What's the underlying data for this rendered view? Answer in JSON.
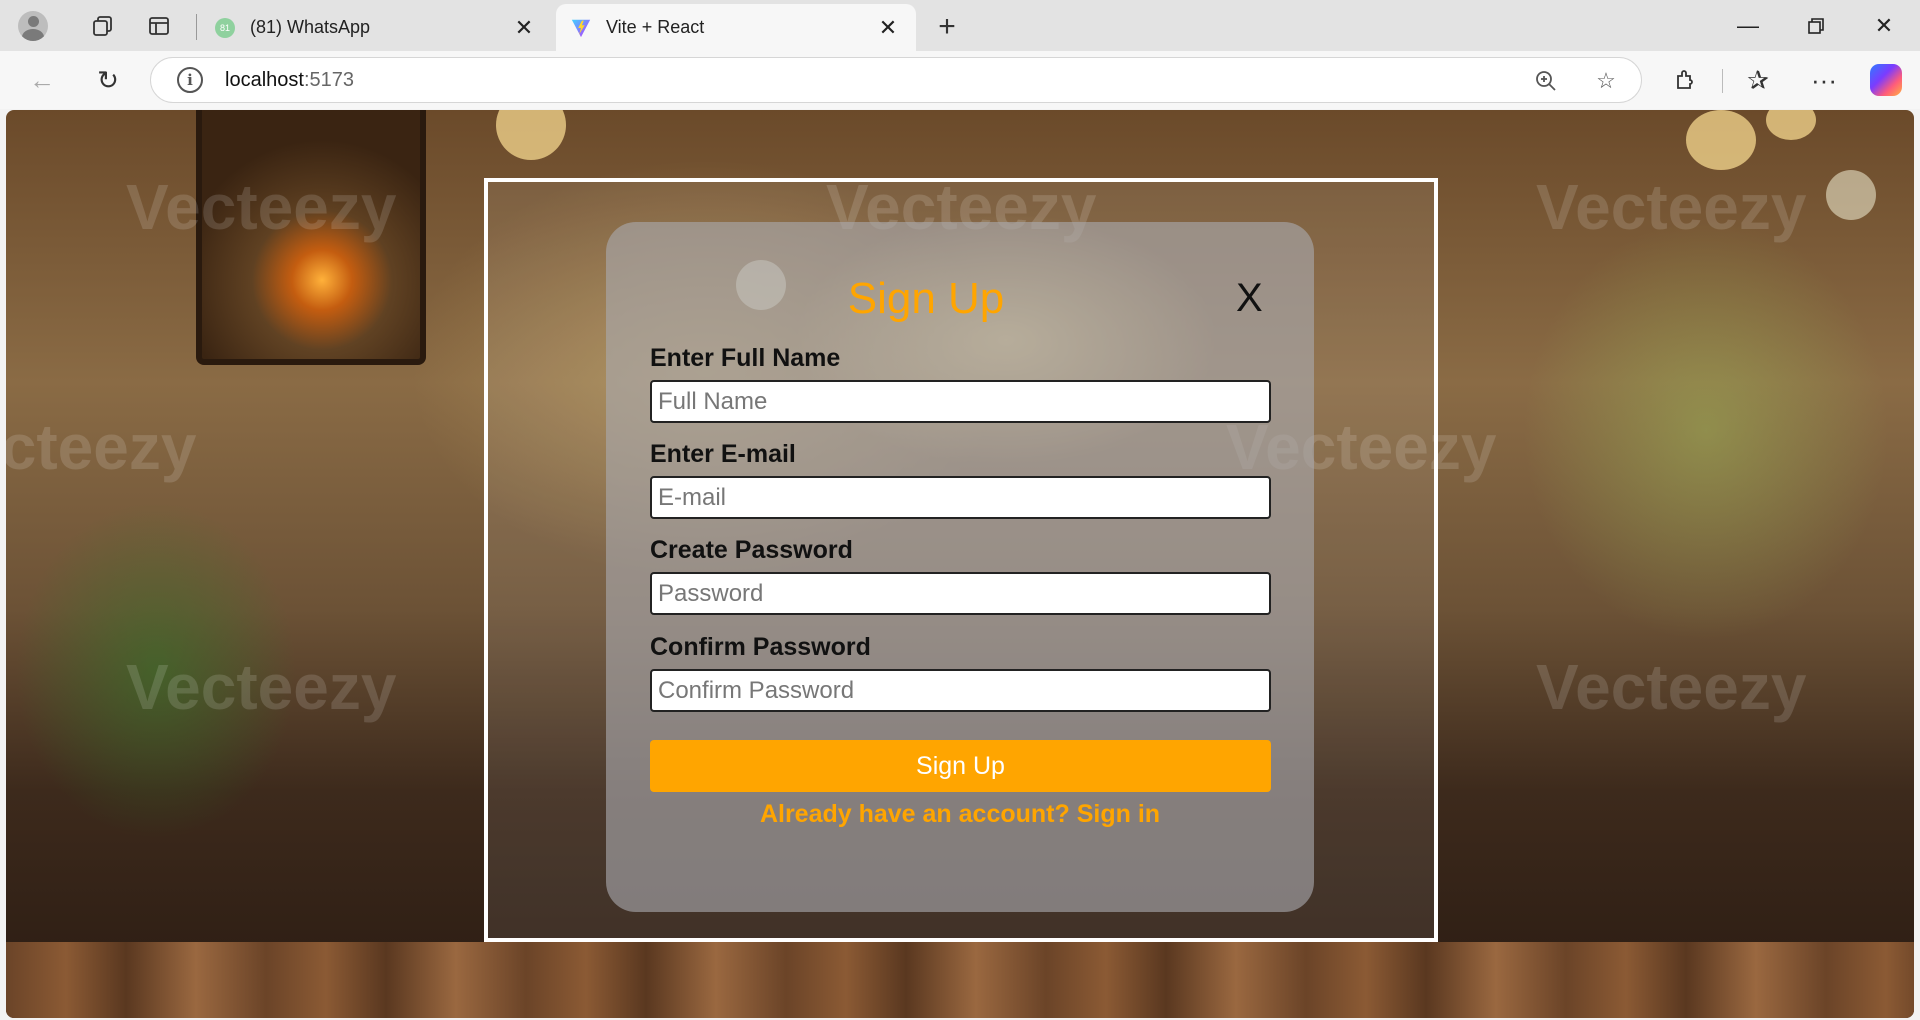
{
  "browser": {
    "tabs": [
      {
        "label": "(81) WhatsApp",
        "favicon": "whatsapp-icon",
        "badge": "81"
      },
      {
        "label": "Vite + React",
        "favicon": "vite-icon"
      }
    ],
    "url_host": "localhost",
    "url_port": ":5173"
  },
  "background": {
    "watermark": "Vecteezy"
  },
  "signup": {
    "title": "Sign Up",
    "close_label": "X",
    "fields": [
      {
        "label": "Enter Full Name",
        "placeholder": "Full Name"
      },
      {
        "label": "Enter E-mail",
        "placeholder": "E-mail"
      },
      {
        "label": "Create Password",
        "placeholder": "Password"
      },
      {
        "label": "Confirm Password",
        "placeholder": "Confirm Password"
      }
    ],
    "submit_label": "Sign Up",
    "signin_text": "Already have an account? Sign in"
  },
  "colors": {
    "accent": "#ffa500",
    "frame_border": "#ffffff"
  }
}
